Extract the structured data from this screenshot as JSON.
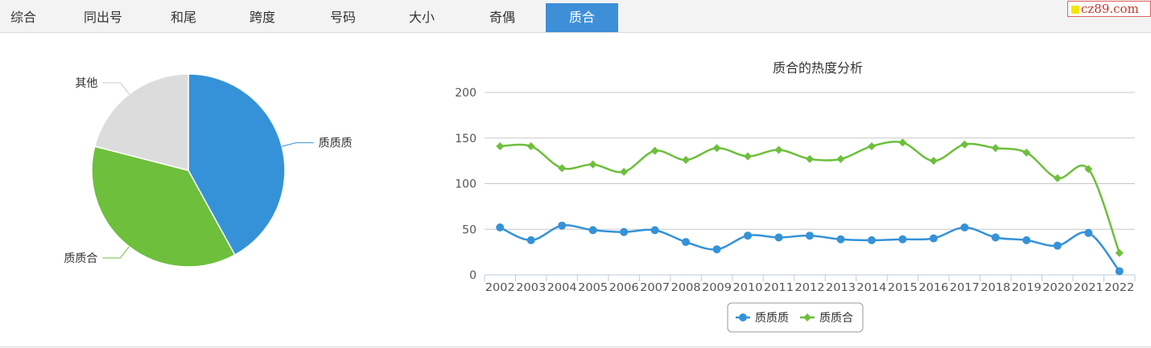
{
  "tabs": [
    {
      "label": "综合",
      "active": false
    },
    {
      "label": "同出号",
      "active": false
    },
    {
      "label": "和尾",
      "active": false
    },
    {
      "label": "跨度",
      "active": false
    },
    {
      "label": "号码",
      "active": false
    },
    {
      "label": "大小",
      "active": false
    },
    {
      "label": "奇偶",
      "active": false
    },
    {
      "label": "质合",
      "active": true
    }
  ],
  "brand": "cz89.com",
  "colors": {
    "blue": "#3592d8",
    "green": "#6dbf3c",
    "gray": "#dcdcdc",
    "active_tab": "#3d8fd8"
  },
  "chart_data": [
    {
      "type": "pie",
      "labels": [
        "质质质",
        "质质合",
        "其他"
      ],
      "values": [
        42,
        37,
        21
      ],
      "colors": [
        "#3592d8",
        "#6dbf3c",
        "#dcdcdc"
      ]
    },
    {
      "type": "line",
      "title": "质合的热度分析",
      "x": [
        "2002",
        "2003",
        "2004",
        "2005",
        "2006",
        "2007",
        "2008",
        "2009",
        "2010",
        "2011",
        "2012",
        "2013",
        "2014",
        "2015",
        "2016",
        "2017",
        "2018",
        "2019",
        "2020",
        "2021",
        "2022"
      ],
      "ylim": [
        0,
        200
      ],
      "yticks": [
        0,
        50,
        100,
        150,
        200
      ],
      "grid": true,
      "legend": "bottom-center",
      "series": [
        {
          "name": "质质质",
          "marker": "circle",
          "color": "#3592d8",
          "values": [
            52,
            38,
            54,
            49,
            47,
            49,
            36,
            28,
            43,
            41,
            43,
            39,
            38,
            39,
            40,
            52,
            41,
            38,
            32,
            46,
            4
          ]
        },
        {
          "name": "质质合",
          "marker": "diamond",
          "color": "#6dbf3c",
          "values": [
            141,
            141,
            117,
            121,
            113,
            136,
            126,
            139,
            130,
            137,
            127,
            127,
            141,
            145,
            125,
            143,
            139,
            134,
            106,
            116,
            24
          ]
        }
      ]
    }
  ]
}
